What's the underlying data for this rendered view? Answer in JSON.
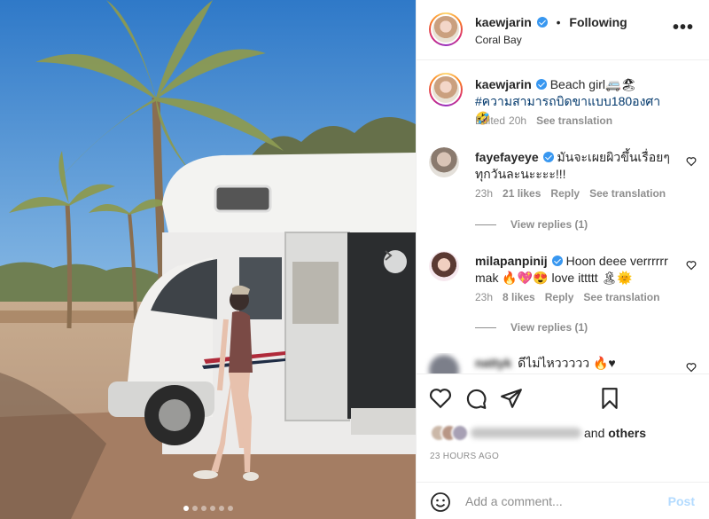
{
  "post": {
    "username": "kaewjarin",
    "follow_status": "Following",
    "location": "Coral Bay",
    "bullet": "•",
    "more_label": "•••",
    "carousel": {
      "slide_count": 6,
      "active_index": 0
    }
  },
  "caption": {
    "username": "kaewjarin",
    "text": "Beach girl",
    "emoji": "🚐🏖",
    "hashtag": "#ความสามารถบิดขาแบบ180องศา",
    "emoji_end": "🤣",
    "edited": "Edited",
    "age": "20h",
    "see_translation": "See translation"
  },
  "comments": [
    {
      "username": "fayefayeye",
      "text": "มันจะเผยผิวขึ้นเรื่อยๆทุกวันละนะะะะ!!!",
      "age": "23h",
      "likes": "21 likes",
      "reply": "Reply",
      "see_translation": "See translation",
      "view_replies": "View replies (1)"
    },
    {
      "username": "milapanpinij",
      "text": "Hoon deee verrrrrr mak 🔥💖😍 love ittttt 🏝🌞",
      "age": "23h",
      "likes": "8 likes",
      "reply": "Reply",
      "see_translation": "See translation",
      "view_replies": "View replies (1)"
    },
    {
      "username_blurred": "nattyk",
      "text": "ดีไม่ไหววววว 🔥♥"
    }
  ],
  "likes": {
    "others_prefix": "and",
    "others_label": "others"
  },
  "timestamp": "23 HOURS AGO",
  "composer": {
    "placeholder": "Add a comment...",
    "post_label": "Post"
  },
  "icons": {
    "heart": "heart-icon",
    "comment": "comment-icon",
    "share": "paper-plane-icon",
    "save": "bookmark-icon",
    "emoji": "smiley-icon",
    "next": "chevron-right-icon",
    "verified": "verified-badge-icon"
  },
  "colors": {
    "link_blue": "#00376b",
    "verified": "#3897f0",
    "muted": "#8e8e8e",
    "post_disabled": "#b3dbff"
  }
}
